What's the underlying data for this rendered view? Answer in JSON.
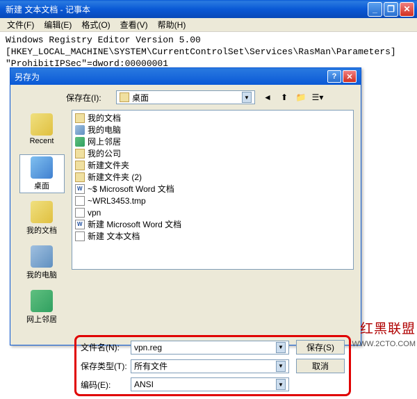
{
  "window": {
    "title": "新建 文本文档 - 记事本"
  },
  "menu": {
    "file": "文件(F)",
    "edit": "编辑(E)",
    "format": "格式(O)",
    "view": "查看(V)",
    "help": "帮助(H)"
  },
  "content": {
    "line1": "Windows Registry Editor Version 5.00",
    "line2": "[HKEY_LOCAL_MACHINE\\SYSTEM\\CurrentControlSet\\Services\\RasMan\\Parameters]",
    "line3": "\"ProhibitIPSec\"=dword:00000001"
  },
  "dialog": {
    "title": "另存为",
    "save_in_label": "保存在(I):",
    "save_in_value": "桌面",
    "sidebar": {
      "recent": "Recent",
      "desktop": "桌面",
      "docs": "我的文档",
      "pc": "我的电脑",
      "net": "网上邻居"
    },
    "files": [
      "我的文档",
      "我的电脑",
      "网上邻居",
      "我的公司",
      "新建文件夹",
      "新建文件夹 (2)",
      "~$ Microsoft Word 文档",
      "~WRL3453.tmp",
      "vpn",
      "新建 Microsoft Word 文档",
      "新建 文本文档"
    ],
    "filename_label": "文件名(N):",
    "filename_value": "vpn.reg",
    "filetype_label": "保存类型(T):",
    "filetype_value": "所有文件",
    "encoding_label": "编码(E):",
    "encoding_value": "ANSI",
    "save_btn": "保存(S)",
    "cancel_btn": "取消"
  },
  "watermark": {
    "text1": "红黑联盟",
    "text2": "WWW.2CTO.COM"
  }
}
